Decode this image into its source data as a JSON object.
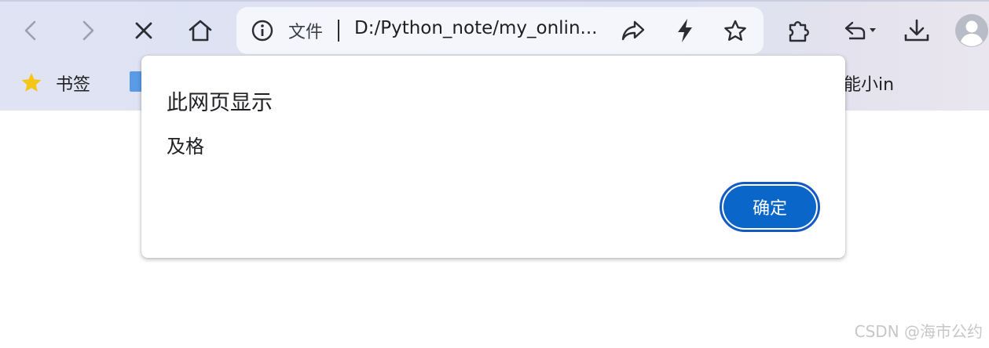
{
  "browser": {
    "omnibox": {
      "site_info_label": "文件",
      "url": "D:/Python_note/my_onlin..."
    },
    "bookmarks_bar": {
      "bookmarks_label": "书签",
      "partial_item_label": "能小in"
    }
  },
  "dialog": {
    "title": "此网页显示",
    "message": "及格",
    "ok_label": "确定"
  },
  "watermark": "CSDN @海市公约",
  "colors": {
    "chrome_bg": "#dfe3f3",
    "accent": "#0b66c9",
    "star_bookmark": "#f5c518"
  },
  "icons": {
    "back": "chevron-left-icon",
    "forward": "chevron-right-icon",
    "stop": "close-icon",
    "home": "home-icon",
    "site_info": "info-icon",
    "share": "share-icon",
    "lightning": "lightning-icon",
    "bookmark_star": "star-outline-icon",
    "extensions": "puzzle-icon",
    "history": "undo-icon",
    "download": "download-icon",
    "profile": "avatar-icon"
  }
}
